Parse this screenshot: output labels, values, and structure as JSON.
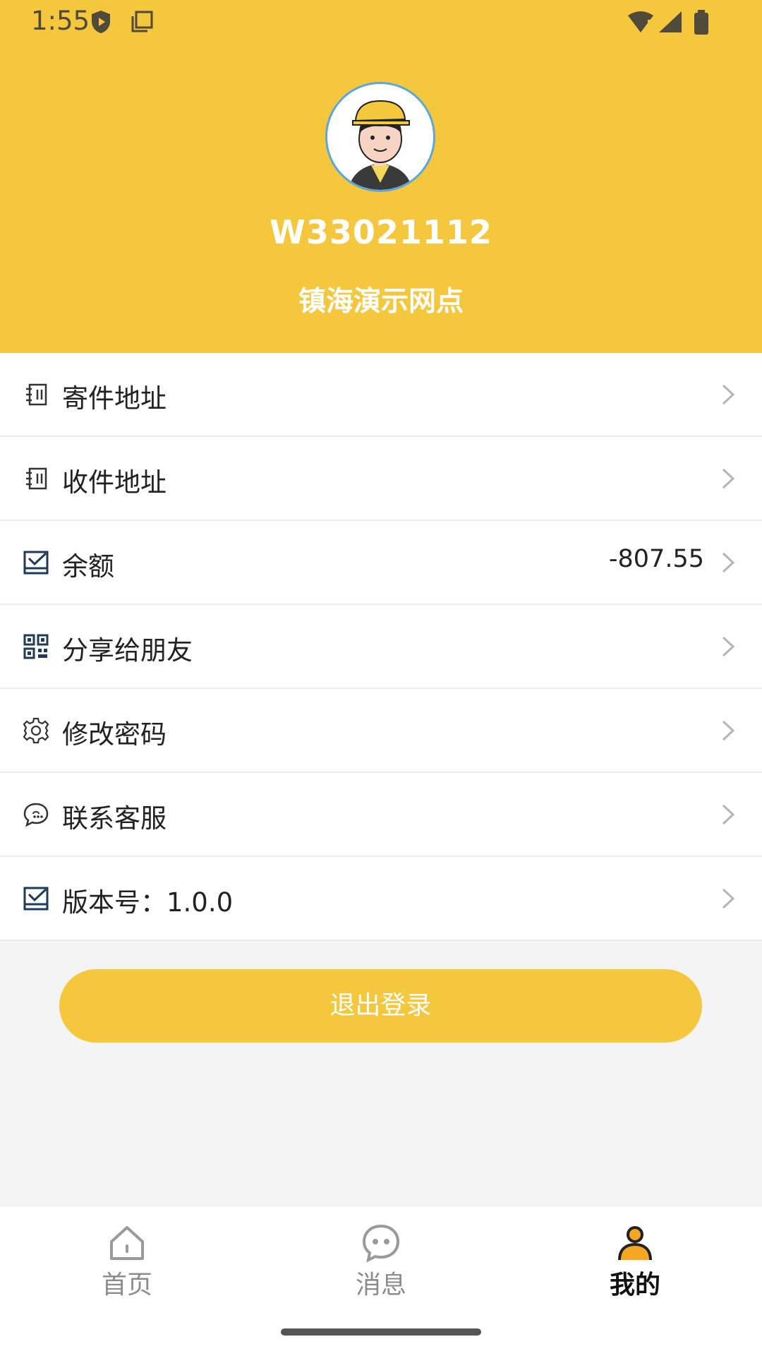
{
  "status_bar": {
    "time": "1:55"
  },
  "profile": {
    "user_id": "W33021112",
    "station_name": "镇海演示网点"
  },
  "menu": {
    "items": [
      {
        "label": "寄件地址",
        "icon": "address-book-icon",
        "value": ""
      },
      {
        "label": "收件地址",
        "icon": "address-book-icon",
        "value": ""
      },
      {
        "label": "余额",
        "icon": "inbox-icon",
        "value": "-807.55"
      },
      {
        "label": "分享给朋友",
        "icon": "qr-code-icon",
        "value": ""
      },
      {
        "label": "修改密码",
        "icon": "gear-icon",
        "value": ""
      },
      {
        "label": "联系客服",
        "icon": "chat-bubble-icon",
        "value": ""
      },
      {
        "label": "版本号：1.0.0",
        "icon": "inbox-icon",
        "value": ""
      }
    ]
  },
  "logout_label": "退出登录",
  "tabbar": {
    "tabs": [
      {
        "label": "首页",
        "icon": "home-icon",
        "active": false
      },
      {
        "label": "消息",
        "icon": "message-icon",
        "active": false
      },
      {
        "label": "我的",
        "icon": "profile-icon",
        "active": true
      }
    ]
  },
  "colors": {
    "accent": "#f5c73d",
    "active_tab_icon": "#f5a623"
  }
}
